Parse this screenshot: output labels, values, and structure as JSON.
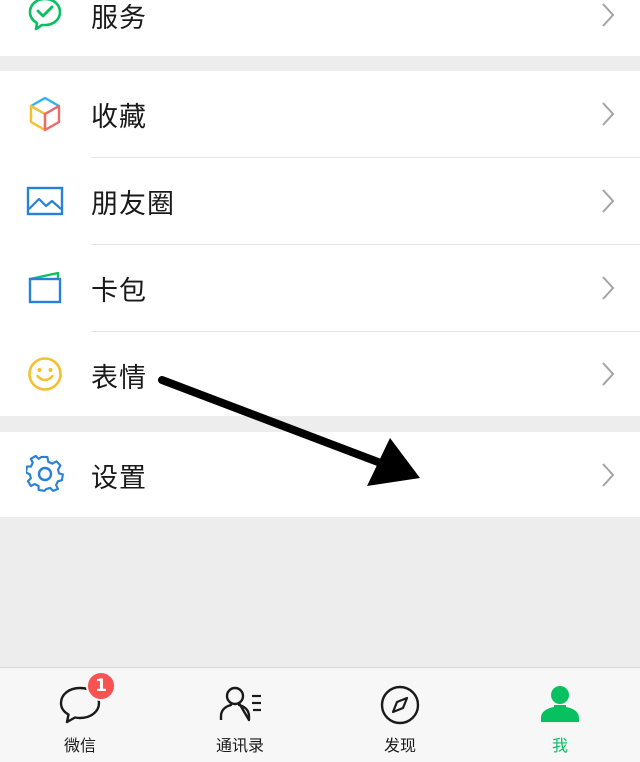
{
  "menu": {
    "services": {
      "label": "服务",
      "icon": "wechat-pay-icon"
    },
    "group2": [
      {
        "label": "收藏",
        "icon": "favorites-cube-icon"
      },
      {
        "label": "朋友圈",
        "icon": "moments-image-icon"
      },
      {
        "label": "卡包",
        "icon": "card-wallet-icon"
      },
      {
        "label": "表情",
        "icon": "smiley-icon"
      }
    ],
    "settings": {
      "label": "设置",
      "icon": "gear-icon"
    }
  },
  "tabbar": {
    "tabs": [
      {
        "label": "微信",
        "icon": "chat-bubble-icon",
        "badge": "1"
      },
      {
        "label": "通讯录",
        "icon": "contacts-icon"
      },
      {
        "label": "发现",
        "icon": "compass-icon"
      },
      {
        "label": "我",
        "icon": "person-icon",
        "active": true
      }
    ]
  },
  "colors": {
    "accent": "#07c160",
    "badge": "#fa5151",
    "background": "#ededed",
    "icon_blue": "#2782d7",
    "icon_yellow": "#f5c02c"
  }
}
